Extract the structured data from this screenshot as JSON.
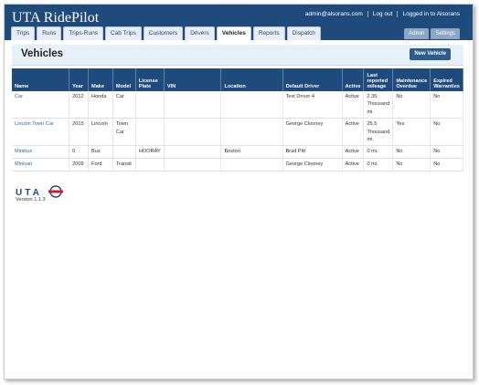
{
  "app": {
    "title": "UTA RidePilot"
  },
  "header": {
    "user_email": "admin@alsorans.com",
    "logout": "Log out",
    "logged_in": "Logged in to Alsorans"
  },
  "tabs": [
    {
      "label": "Trips"
    },
    {
      "label": "Runs"
    },
    {
      "label": "Trips-Runs"
    },
    {
      "label": "Cab Trips"
    },
    {
      "label": "Customers"
    },
    {
      "label": "Drivers"
    },
    {
      "label": "Vehicles"
    },
    {
      "label": "Reports"
    },
    {
      "label": "Dispatch"
    }
  ],
  "active_tab": "Vehicles",
  "right_tabs": [
    {
      "label": "Admin"
    },
    {
      "label": "Settings"
    }
  ],
  "page": {
    "title": "Vehicles",
    "new_button": "New Vehicle"
  },
  "table": {
    "columns": [
      "Name",
      "Year",
      "Make",
      "Model",
      "License Plate",
      "VIN",
      "Location",
      "Default Driver",
      "Active",
      "Last reported mileage",
      "Maintenance Overdue",
      "Expired Warranties"
    ],
    "rows": [
      {
        "name": "Car",
        "year": "2012",
        "make": "Honda",
        "model": "Car",
        "plate": "",
        "vin": "",
        "location": "",
        "driver": "Test Driver 4",
        "active": "Active",
        "mileage": "2.35 Thousand mi.",
        "overdue": "No",
        "warranties": "No"
      },
      {
        "name": "Lincoln Town Car",
        "year": "2015",
        "make": "Lincoln",
        "model": "Town Car",
        "plate": "",
        "vin": "",
        "location": "",
        "driver": "George Clooney",
        "active": "Active",
        "mileage": "25.5 Thousand mi.",
        "overdue": "Yes",
        "warranties": "No"
      },
      {
        "name": "Minibus",
        "year": "0",
        "make": "Bus",
        "model": "",
        "plate": "HOORAY",
        "vin": "",
        "location": "Boston",
        "driver": "Brad Pitt",
        "active": "Active",
        "mileage": "0 mi.",
        "overdue": "No",
        "warranties": "No"
      },
      {
        "name": "Minivan",
        "year": "2009",
        "make": "Ford",
        "model": "Transit",
        "plate": "",
        "vin": "",
        "location": "",
        "driver": "George Clooney",
        "active": "Active",
        "mileage": "0 mi.",
        "overdue": "No",
        "warranties": "No"
      }
    ]
  },
  "footer": {
    "logo_text": "UTA",
    "version": "Version 1.1.3"
  },
  "colors": {
    "header_bg": "#1f4a7c",
    "link": "#2f6aa8",
    "title_bar": "#e6f0f9",
    "logo_red": "#c8202f"
  }
}
